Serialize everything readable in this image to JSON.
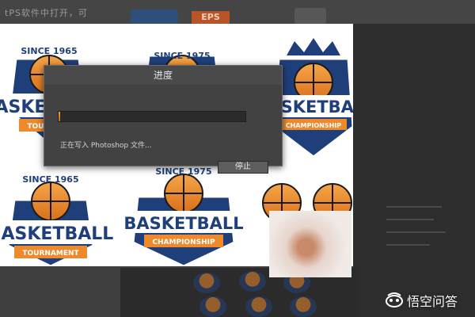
{
  "workspace": {
    "top_hint": "tPS软件中打开，可",
    "format_tag": "EPS"
  },
  "dialog": {
    "title": "进度",
    "progress_fraction": 0.01,
    "status": "正在写入 Photoshop 文件...",
    "stop_label": "停止"
  },
  "canvas": {
    "badges": [
      {
        "top_text": "SINCE 1965",
        "main_text": "BASKETBALL",
        "ribbon_text": "TOURNAMENT"
      },
      {
        "top_text": "SINCE 1975",
        "main_text": "",
        "ribbon_text": ""
      },
      {
        "top_text": "",
        "main_text": "BASKETBALL",
        "ribbon_text": "CHAMPIONSHIP"
      },
      {
        "top_text": "SINCE 1965",
        "main_text": "BASKETBALL",
        "ribbon_text": "TOURNAMENT"
      },
      {
        "top_text": "SINCE 1975",
        "main_text": "BASKETBALL",
        "ribbon_text": "CHAMPIONSHIP"
      }
    ]
  },
  "watermark": {
    "text": "悟空问答"
  },
  "colors": {
    "navy": "#1f3f7a",
    "orange": "#ee8a2c",
    "progress": "#e8902f",
    "dialog_bg": "#424242"
  }
}
